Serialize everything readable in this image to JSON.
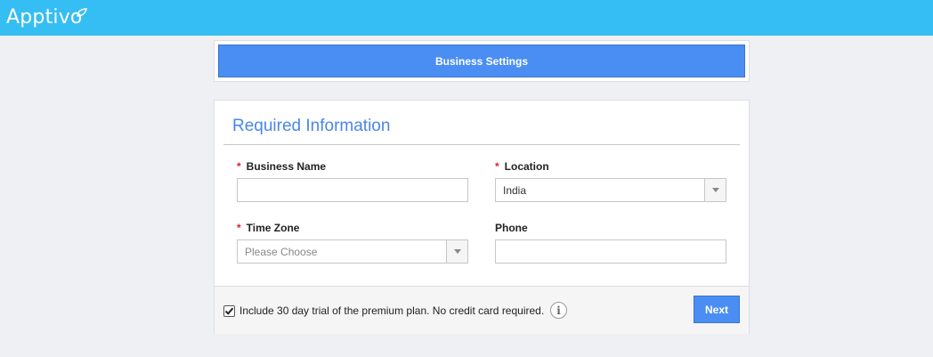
{
  "app": {
    "logo_text": "Apptivo",
    "brand_color": "#35bef3",
    "accent_color": "#4a8ef3"
  },
  "steps": {
    "active_label": "Business Settings"
  },
  "form": {
    "section_title": "Required Information",
    "fields": {
      "business_name": {
        "label": "Business Name",
        "required_mark": "*",
        "value": ""
      },
      "location": {
        "label": "Location",
        "required_mark": "*",
        "selected": "India"
      },
      "time_zone": {
        "label": "Time Zone",
        "required_mark": "*",
        "placeholder": "Please Choose"
      },
      "phone": {
        "label": "Phone",
        "value": ""
      }
    }
  },
  "footer": {
    "trial_checked": true,
    "trial_label": "Include 30 day trial of the premium plan. No credit card required.",
    "info_icon": "info-icon",
    "info_glyph": "i",
    "next_label": "Next"
  }
}
